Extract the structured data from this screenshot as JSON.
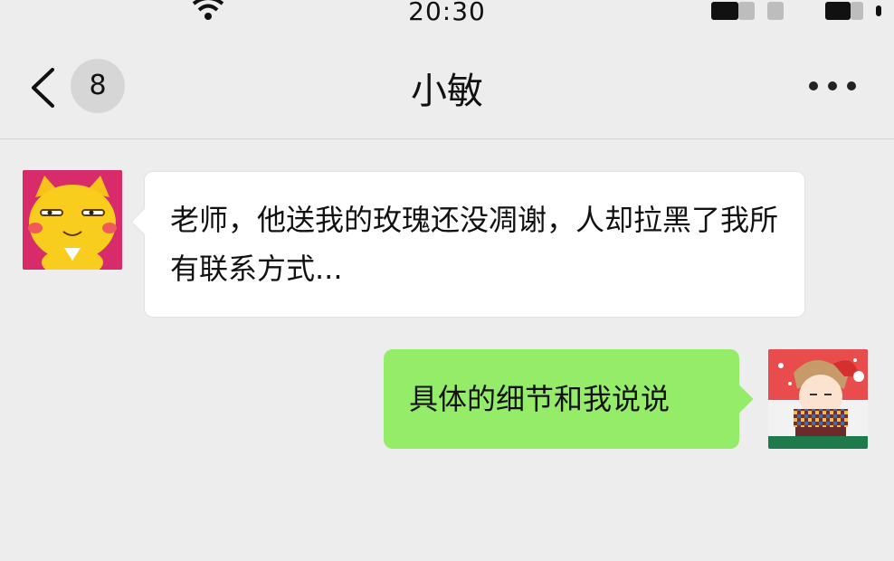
{
  "status_bar": {
    "time": "20:30",
    "wifi_icon": "wifi-icon",
    "battery_icon": "battery-icon"
  },
  "nav": {
    "back_icon": "chevron-left-icon",
    "unread_count": "8",
    "title": "小敏",
    "more_icon": "more-dots-icon"
  },
  "messages": [
    {
      "direction": "incoming",
      "avatar": "cartoon-cat-avatar",
      "text": "老师，他送我的玫瑰还没凋谢，人却拉黑了我所有联系方式..."
    },
    {
      "direction": "outgoing",
      "avatar": "cartoon-boy-avatar",
      "text": "具体的细节和我说说"
    }
  ],
  "colors": {
    "background": "#ededed",
    "incoming_bubble": "#ffffff",
    "outgoing_bubble": "#95ec69",
    "badge": "#d6d6d6"
  }
}
